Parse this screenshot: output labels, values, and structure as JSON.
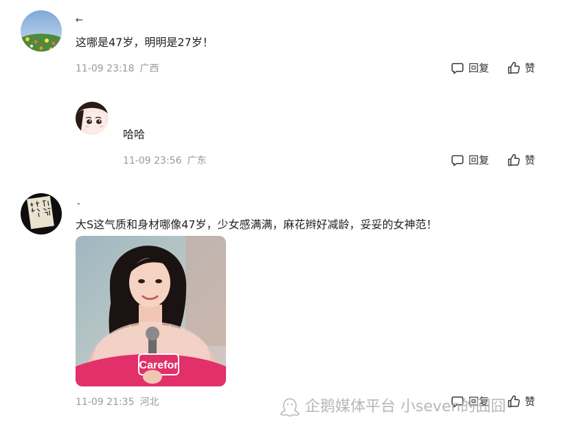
{
  "comments": [
    {
      "username": "←",
      "content": "这哪是47岁，明明是27岁！",
      "time": "11-09 23:18",
      "location": "广西",
      "reply_label": "回复",
      "like_label": "赞"
    },
    {
      "username": "",
      "content": "哈哈",
      "time": "11-09 23:56",
      "location": "广东",
      "reply_label": "回复",
      "like_label": "赞"
    },
    {
      "username": "-",
      "content": "大S这气质和身材哪像47岁，少女感满满，麻花辫好减龄，妥妥的女神范！",
      "time": "11-09 21:35",
      "location": "河北",
      "reply_label": "回复",
      "like_label": "赞",
      "photo_logo": "Carefor"
    }
  ],
  "watermark": "企鹅媒体平台 小seven的囧囧",
  "icons": {
    "reply": "speech-bubble-icon",
    "like": "thumbs-up-icon"
  },
  "colors": {
    "meta_text": "#999999",
    "body_text": "#222222",
    "photo_logo_bg": "#e2306b"
  }
}
